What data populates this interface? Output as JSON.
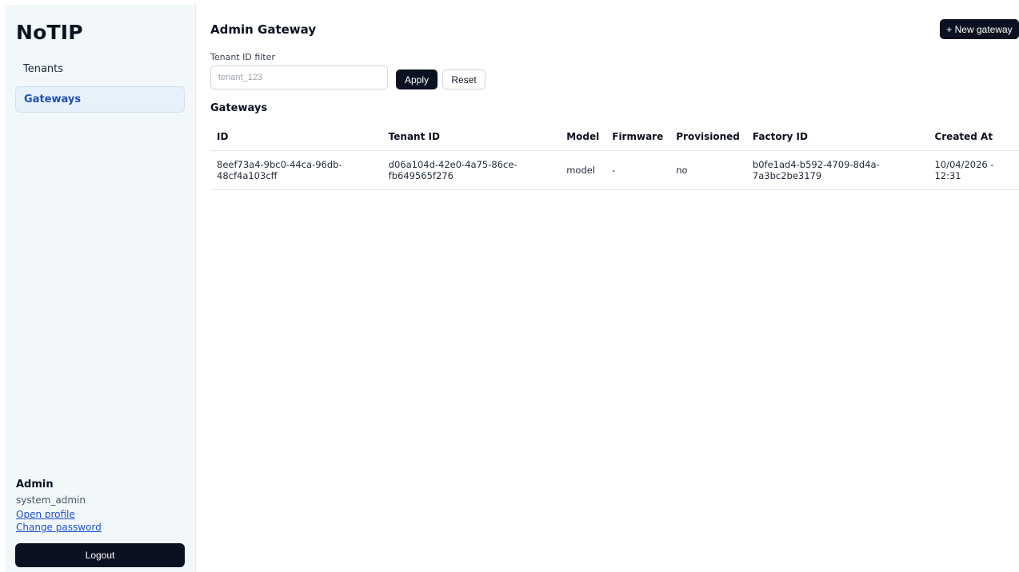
{
  "app": {
    "logo": "NoTIP"
  },
  "sidebar": {
    "items": [
      {
        "label": "Tenants",
        "active": false
      },
      {
        "label": "Gateways",
        "active": true
      }
    ],
    "user": {
      "role": "Admin",
      "username": "system_admin",
      "open_profile": "Open profile",
      "change_password": "Change password"
    },
    "logout_label": "Logout"
  },
  "main": {
    "title": "Admin Gateway",
    "new_button": "+ New gateway",
    "filter": {
      "label": "Tenant ID filter",
      "placeholder": "tenant_123",
      "value": "",
      "apply": "Apply",
      "reset": "Reset"
    },
    "section_title": "Gateways",
    "table": {
      "headers": [
        "ID",
        "Tenant ID",
        "Model",
        "Firmware",
        "Provisioned",
        "Factory ID",
        "Created At"
      ],
      "rows": [
        {
          "id": [
            "8eef73a4-9bc0-44ca-96db-",
            "48cf4a103cff"
          ],
          "tenant_id": [
            "d06a104d-42e0-4a75-86ce-",
            "fb649565f276"
          ],
          "model": "model",
          "firmware": "-",
          "provisioned": "no",
          "factory_id": [
            "b0fe1ad4-b592-4709-8d4a-",
            "7a3bc2be3179"
          ],
          "created_at": [
            "10/04/2026 -",
            "12:31"
          ]
        }
      ]
    }
  },
  "colors": {
    "sidebar_bg": "#f2f8f9",
    "primary_dark": "#0b1120",
    "active_nav_bg": "#e7f1fb",
    "active_nav_text": "#1e4fae",
    "link": "#1d4ed8"
  }
}
